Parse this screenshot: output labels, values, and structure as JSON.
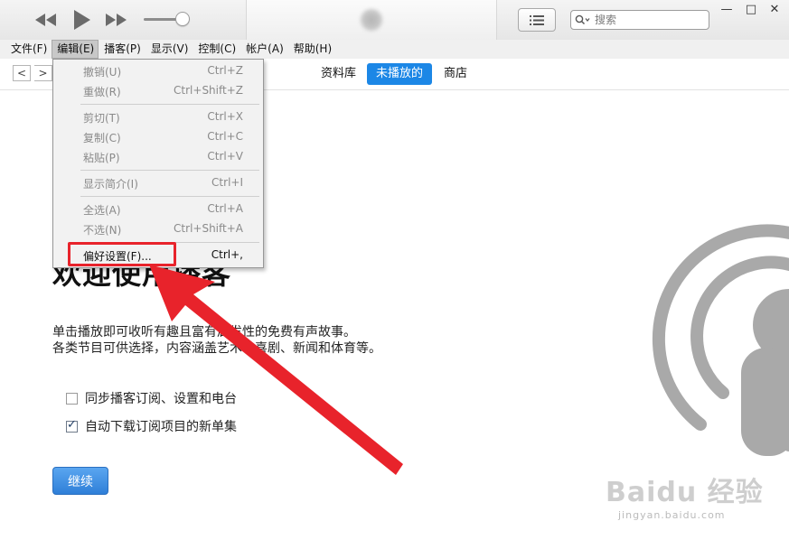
{
  "toolbar": {
    "rewind_icon": "rewind-icon",
    "play_icon": "play-icon",
    "forward_icon": "fast-forward-icon",
    "list_icon": "list-view-icon",
    "search_placeholder": "搜索"
  },
  "window": {
    "minimize": "—",
    "maximize": "□",
    "close": "✕"
  },
  "menubar": {
    "items": [
      "文件(F)",
      "编辑(E)",
      "播客(P)",
      "显示(V)",
      "控制(C)",
      "帐户(A)",
      "帮助(H)"
    ],
    "active_index": 1
  },
  "nav": {
    "back": "<",
    "forward": ">",
    "tabs": [
      "资料库",
      "未播放的",
      "商店"
    ],
    "selected_tab": "未播放的"
  },
  "edit_menu": {
    "items": [
      {
        "label": "撤销(U)",
        "shortcut": "Ctrl+Z",
        "enabled": false
      },
      {
        "label": "重做(R)",
        "shortcut": "Ctrl+Shift+Z",
        "enabled": false
      },
      {
        "label": "剪切(T)",
        "shortcut": "Ctrl+X",
        "enabled": false
      },
      {
        "label": "复制(C)",
        "shortcut": "Ctrl+C",
        "enabled": false
      },
      {
        "label": "粘贴(P)",
        "shortcut": "Ctrl+V",
        "enabled": false
      },
      {
        "label": "显示简介(I)",
        "shortcut": "Ctrl+I",
        "enabled": false
      },
      {
        "label": "全选(A)",
        "shortcut": "Ctrl+A",
        "enabled": false
      },
      {
        "label": "不选(N)",
        "shortcut": "Ctrl+Shift+A",
        "enabled": false
      },
      {
        "label": "偏好设置(F)...",
        "shortcut": "Ctrl+,",
        "enabled": true
      }
    ]
  },
  "main": {
    "title": "欢迎使用播客",
    "description_line1": "单击播放即可收听有趣且富有启发性的免费有声故事。",
    "description_line2": "各类节目可供选择，内容涵盖艺术、喜剧、新闻和体育等。",
    "options": [
      {
        "label": "同步播客订阅、设置和电台",
        "checked": false
      },
      {
        "label": "自动下载订阅项目的新单集",
        "checked": true
      }
    ],
    "continue_label": "继续"
  },
  "watermark": {
    "text": "Baidu 经验",
    "url": "jingyan.baidu.com"
  },
  "colors": {
    "accent": "#1c87e6",
    "annotation_red": "#e8232b",
    "podcast_icon": "#a7a7a7"
  }
}
